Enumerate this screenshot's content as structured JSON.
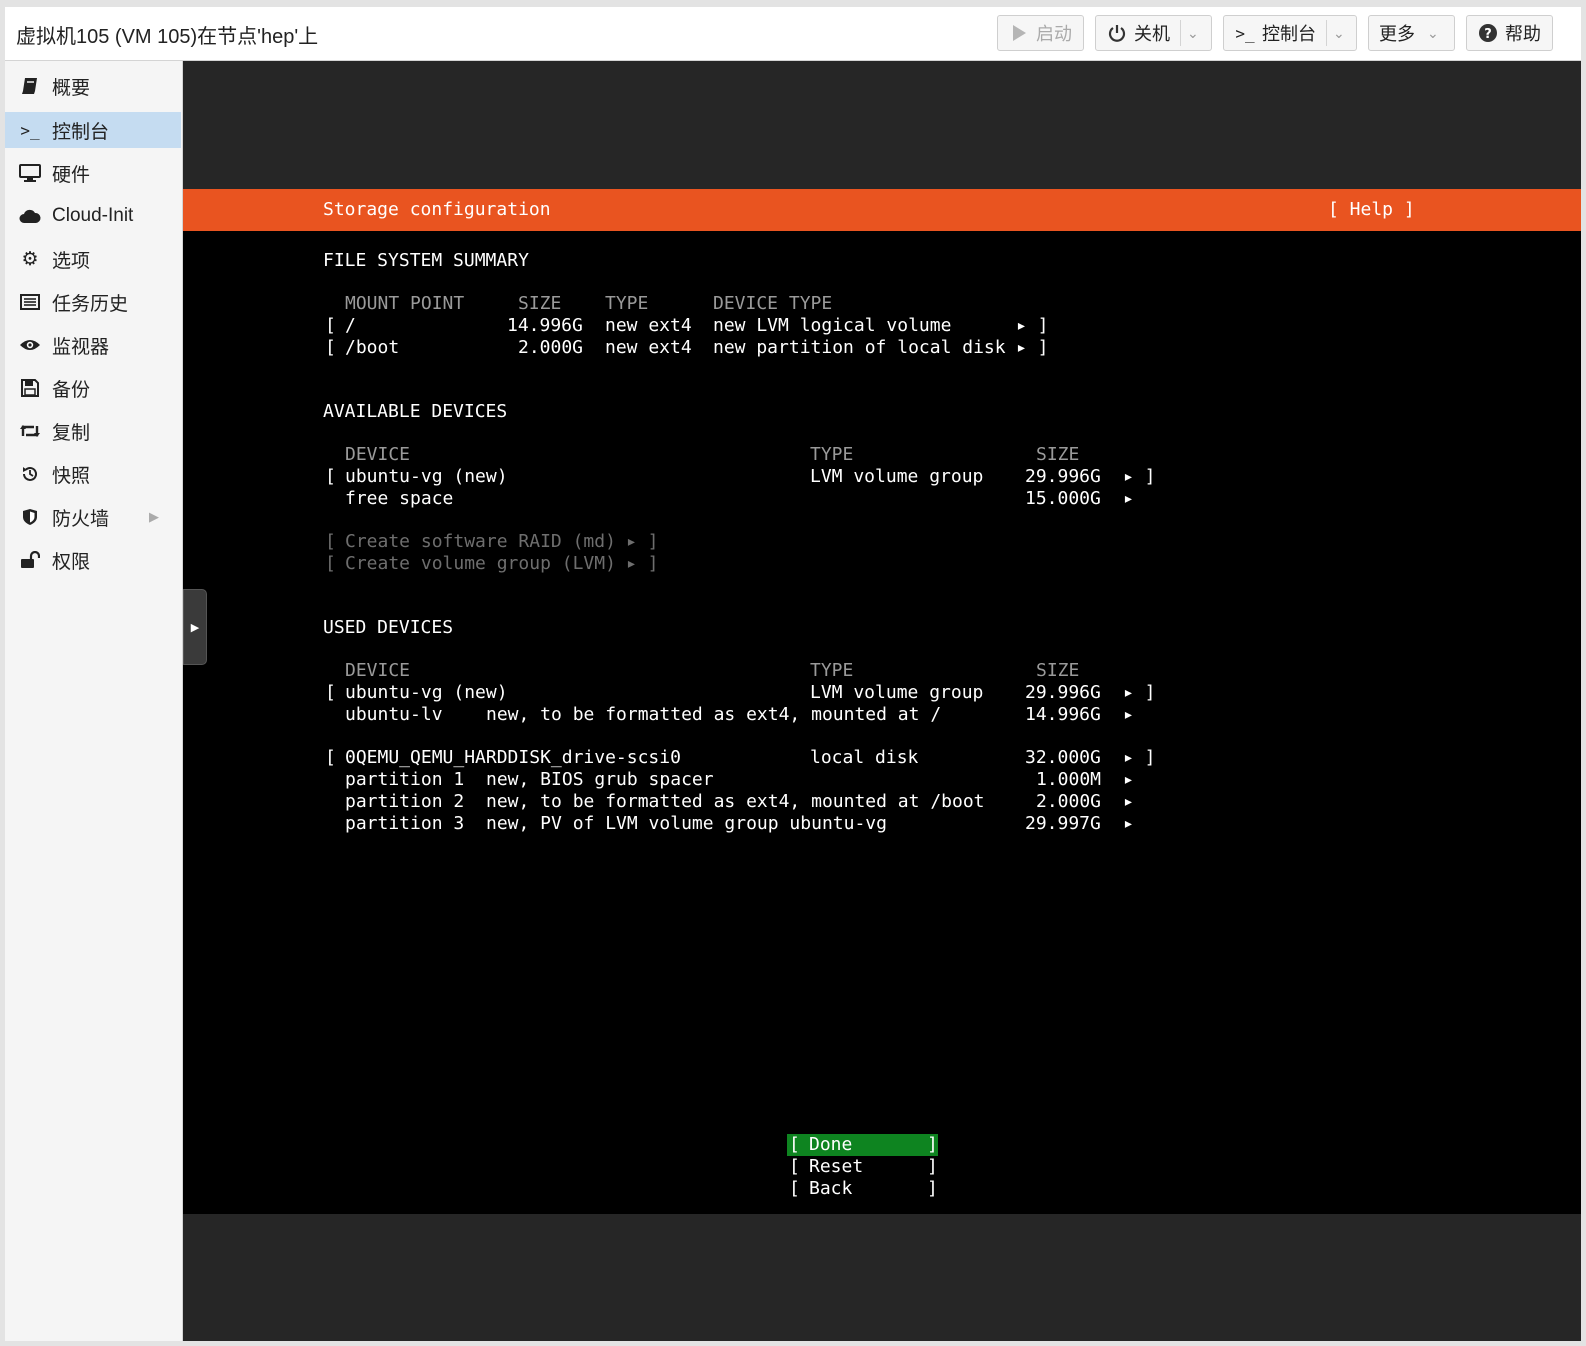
{
  "window": {
    "title": "虚拟机105 (VM 105)在节点'hep'上"
  },
  "toolbar": {
    "start": "启动",
    "shutdown": "关机",
    "console": "控制台",
    "more": "更多",
    "help": "帮助"
  },
  "sidebar": {
    "items": [
      {
        "label": "概要",
        "icon": "book-icon"
      },
      {
        "label": "控制台",
        "icon": "terminal-icon"
      },
      {
        "label": "硬件",
        "icon": "desktop-icon"
      },
      {
        "label": "Cloud-Init",
        "icon": "cloud-icon"
      },
      {
        "label": "选项",
        "icon": "gear-icon"
      },
      {
        "label": "任务历史",
        "icon": "list-icon"
      },
      {
        "label": "监视器",
        "icon": "eye-icon"
      },
      {
        "label": "备份",
        "icon": "floppy-icon"
      },
      {
        "label": "复制",
        "icon": "retweet-icon"
      },
      {
        "label": "快照",
        "icon": "history-icon"
      },
      {
        "label": "防火墙",
        "icon": "shield-icon"
      },
      {
        "label": "权限",
        "icon": "unlock-icon"
      }
    ]
  },
  "installer": {
    "header_title": "Storage configuration",
    "header_help": "[ Help ]",
    "fs_summary": {
      "heading": "FILE SYSTEM SUMMARY",
      "columns": [
        "MOUNT POINT",
        "SIZE",
        "TYPE",
        "DEVICE TYPE"
      ],
      "rows": [
        {
          "mount": "/",
          "size": "14.996G",
          "type": "new ext4",
          "device_type": "new LVM logical volume"
        },
        {
          "mount": "/boot",
          "size": "2.000G",
          "type": "new ext4",
          "device_type": "new partition of local disk"
        }
      ]
    },
    "available": {
      "heading": "AVAILABLE DEVICES",
      "columns": [
        "DEVICE",
        "TYPE",
        "SIZE"
      ],
      "rows": [
        {
          "device": "ubuntu-vg (new)",
          "type": "LVM volume group",
          "size": "29.996G"
        },
        {
          "device": "free space",
          "type": "",
          "size": "15.000G"
        }
      ],
      "actions": [
        "Create software RAID (md)",
        "Create volume group (LVM)"
      ]
    },
    "used": {
      "heading": "USED DEVICES",
      "columns": [
        "DEVICE",
        "TYPE",
        "SIZE"
      ],
      "groups": [
        {
          "device": "ubuntu-vg (new)",
          "type": "LVM volume group",
          "size": "29.996G",
          "children": [
            {
              "name": "ubuntu-lv",
              "desc": "new, to be formatted as ext4, mounted at /",
              "size": "14.996G"
            }
          ]
        },
        {
          "device": "0QEMU_QEMU_HARDDISK_drive-scsi0",
          "type": "local disk",
          "size": "32.000G",
          "children": [
            {
              "name": "partition 1",
              "desc": "new, BIOS grub spacer",
              "size": "1.000M"
            },
            {
              "name": "partition 2",
              "desc": "new, to be formatted as ext4, mounted at /boot",
              "size": "2.000G"
            },
            {
              "name": "partition 3",
              "desc": "new, PV of LVM volume group ubuntu-vg",
              "size": "29.997G"
            }
          ]
        }
      ]
    },
    "buttons": [
      "Done",
      "Reset",
      "Back"
    ]
  },
  "colors": {
    "accent_orange": "#e95420",
    "focus_green": "#0e8420",
    "selected_nav": "#c5dcf1"
  }
}
